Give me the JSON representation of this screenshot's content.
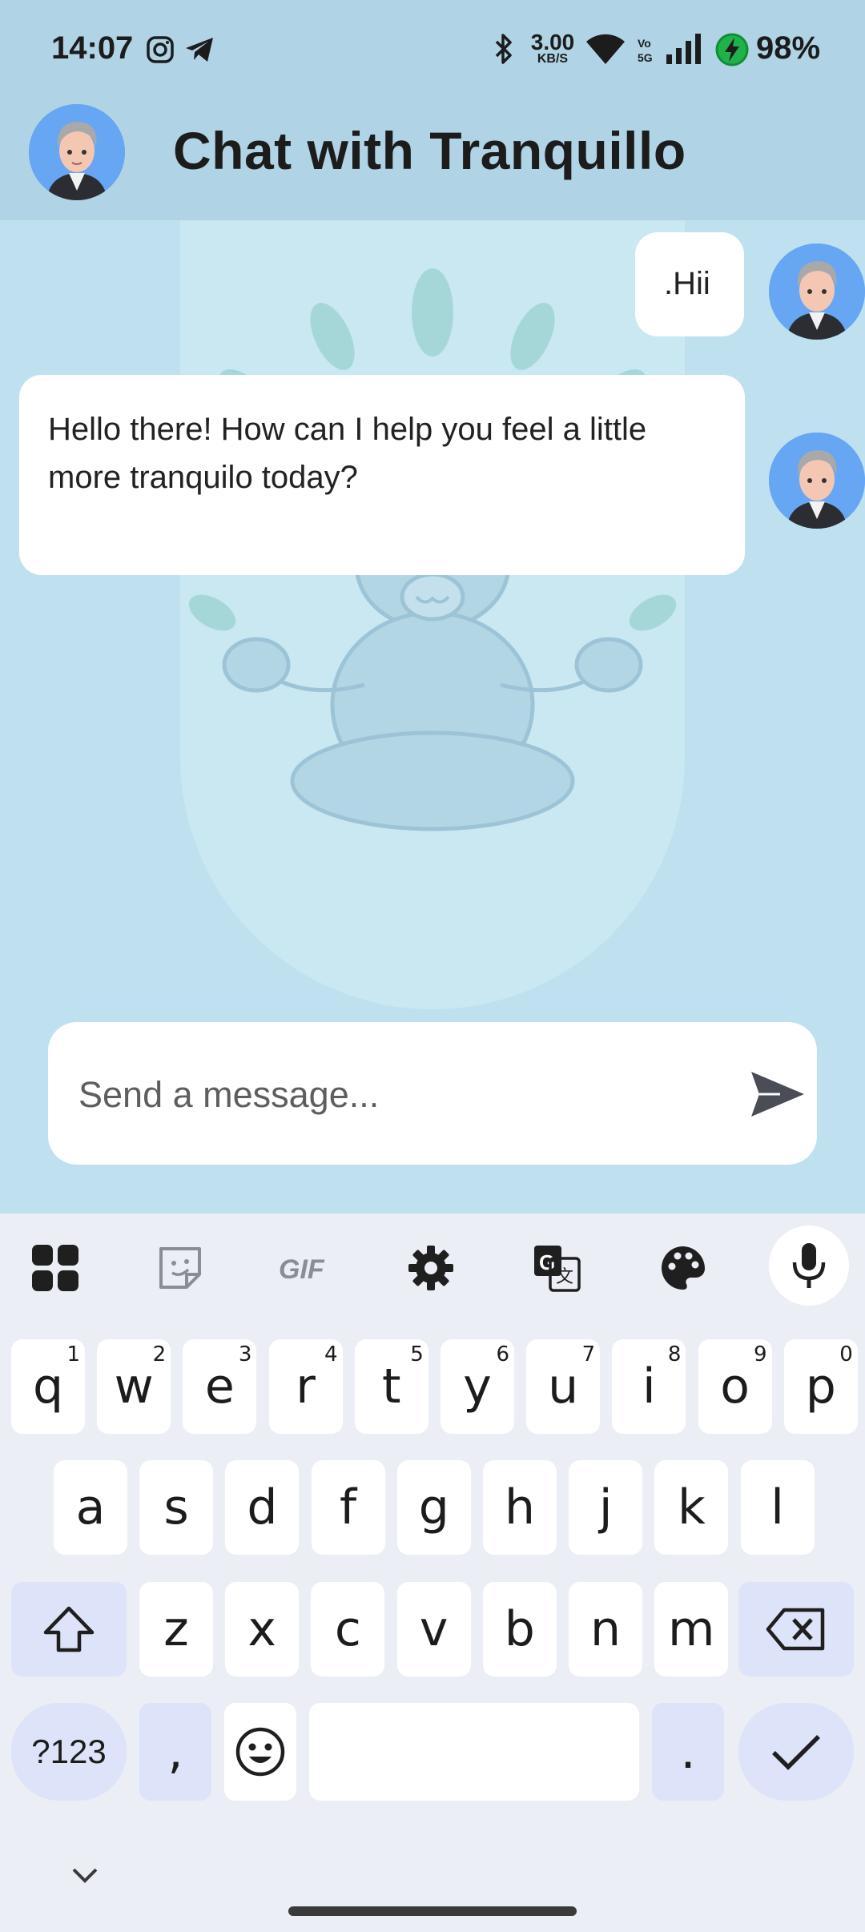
{
  "status_bar": {
    "time": "14:07",
    "net_speed_value": "3.00",
    "net_speed_unit": "KB/S",
    "battery": "98%"
  },
  "header": {
    "title": "Chat with Tranquillo"
  },
  "messages": [
    {
      "sender": "user",
      "text": ".Hii"
    },
    {
      "sender": "bot",
      "text": "Hello there! How can I help you feel a little more tranquilo today?"
    }
  ],
  "composer": {
    "placeholder": "Send a message..."
  },
  "keyboard": {
    "toolbar": [
      "apps-icon",
      "sticker-icon",
      "GIF",
      "settings-icon",
      "translate-icon",
      "palette-icon",
      "mic-icon"
    ],
    "row1": [
      {
        "key": "q",
        "hint": "1"
      },
      {
        "key": "w",
        "hint": "2"
      },
      {
        "key": "e",
        "hint": "3"
      },
      {
        "key": "r",
        "hint": "4"
      },
      {
        "key": "t",
        "hint": "5"
      },
      {
        "key": "y",
        "hint": "6"
      },
      {
        "key": "u",
        "hint": "7"
      },
      {
        "key": "i",
        "hint": "8"
      },
      {
        "key": "o",
        "hint": "9"
      },
      {
        "key": "p",
        "hint": "0"
      }
    ],
    "row2": [
      "a",
      "s",
      "d",
      "f",
      "g",
      "h",
      "j",
      "k",
      "l"
    ],
    "row3": [
      "z",
      "x",
      "c",
      "v",
      "b",
      "n",
      "m"
    ],
    "symbols_key": "?123",
    "comma_key": ",",
    "period_key": "."
  },
  "colors": {
    "header_bg": "#b0d3e6",
    "chat_bg": "#bfe1ef",
    "bubble_bg": "#ffffff",
    "keyboard_bg": "#eceef5",
    "modifier_key_bg": "#dde3f8"
  }
}
